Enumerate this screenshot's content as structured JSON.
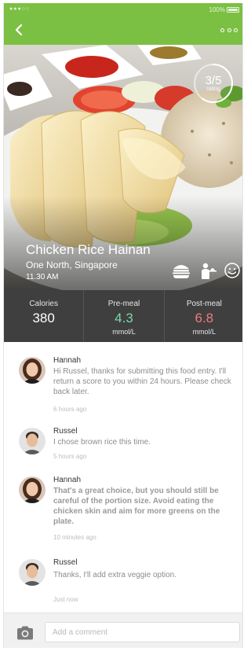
{
  "status_bar": {
    "battery": "100%"
  },
  "meal": {
    "score": "3/5",
    "score_unit": "rating",
    "title": "Chicken Rice Hainan",
    "location": "One North, Singapore",
    "time": "11.30 AM"
  },
  "hero_icons": [
    "burger-icon",
    "waiter-icon",
    "smiley-icon"
  ],
  "stats": [
    {
      "label": "Calories",
      "value": "380",
      "unit": "",
      "color": "#ffffff"
    },
    {
      "label": "Pre-meal",
      "value": "4.3",
      "unit": "mmol/L",
      "color": "#7bd8a7"
    },
    {
      "label": "Post-meal",
      "value": "6.8",
      "unit": "mmol/L",
      "color": "#f07a7a"
    }
  ],
  "comments": [
    {
      "name": "Hannah",
      "text": "Hi Russel, thanks for submitting this food entry. I'll return a score to you within 24 hours. Please check back later.",
      "time": "6 hours ago"
    },
    {
      "name": "Russel",
      "text": "I chose brown rice this time.",
      "time": "5 hours ago"
    },
    {
      "name": "Hannah",
      "text": "That's a great choice, but you should still be careful of the portion size. Avoid eating the chicken skin and aim for more greens on the plate.",
      "time": "10 minutes ago"
    },
    {
      "name": "Russel",
      "text": "Thanks, I'll add extra veggie option.",
      "time": "Just now"
    }
  ],
  "composer": {
    "placeholder": "Add a comment"
  },
  "colors": {
    "accent": "#7bc043",
    "stats_background": "#3f3f3f"
  }
}
